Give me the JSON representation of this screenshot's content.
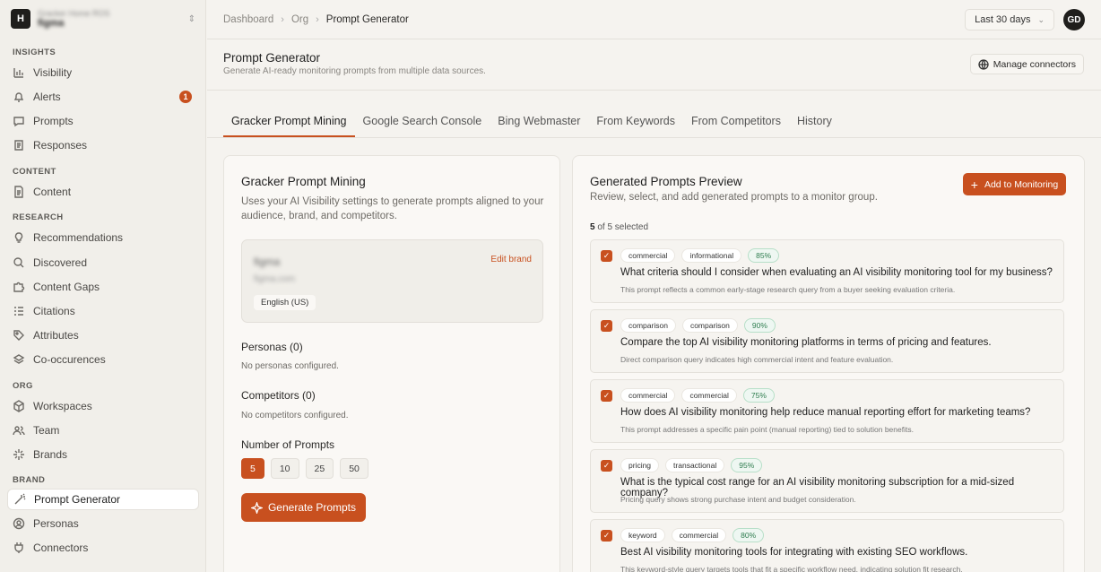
{
  "workspace": {
    "logo": "H",
    "sub": "Gracker Home ROS",
    "name": "figma"
  },
  "sidebar": {
    "sections": [
      "INSIGHTS",
      "CONTENT",
      "RESEARCH",
      "ORG",
      "BRAND"
    ],
    "items": [
      {
        "label": "Visibility",
        "icon": "bar-chart-icon"
      },
      {
        "label": "Alerts",
        "icon": "bell-icon",
        "badge": "1"
      },
      {
        "label": "Prompts",
        "icon": "message-icon"
      },
      {
        "label": "Responses",
        "icon": "clipboard-icon"
      },
      {
        "label": "Content",
        "icon": "document-icon"
      },
      {
        "label": "Recommendations",
        "icon": "lightbulb-icon"
      },
      {
        "label": "Discovered",
        "icon": "search-icon"
      },
      {
        "label": "Content Gaps",
        "icon": "puzzle-icon"
      },
      {
        "label": "Citations",
        "icon": "list-icon"
      },
      {
        "label": "Attributes",
        "icon": "tag-icon"
      },
      {
        "label": "Co-occurences",
        "icon": "layers-icon"
      },
      {
        "label": "Workspaces",
        "icon": "box-icon"
      },
      {
        "label": "Team",
        "icon": "users-icon"
      },
      {
        "label": "Brands",
        "icon": "sparkle-icon"
      },
      {
        "label": "Prompt Generator",
        "icon": "wand-icon"
      },
      {
        "label": "Personas",
        "icon": "user-circle-icon"
      },
      {
        "label": "Connectors",
        "icon": "plug-icon"
      }
    ]
  },
  "breadcrumb": [
    "Dashboard",
    "Org",
    "Prompt Generator"
  ],
  "date_range": "Last 30 days",
  "user_initials": "GD",
  "page": {
    "title": "Prompt Generator",
    "subtitle": "Generate AI-ready monitoring prompts from multiple data sources.",
    "manage_connectors": "Manage connectors"
  },
  "tabs": [
    "Gracker Prompt Mining",
    "Google Search Console",
    "Bing Webmaster",
    "From Keywords",
    "From Competitors",
    "History"
  ],
  "left": {
    "title": "Gracker Prompt Mining",
    "desc1": "Uses your AI Visibility settings to generate prompts aligned to your",
    "desc2": "audience, brand, and competitors.",
    "brand_name": "figma",
    "brand_url": "figma.com",
    "edit_brand": "Edit brand",
    "language": "English (US)",
    "personas_label": "Personas (0)",
    "personas_empty": "No personas configured.",
    "competitors_label": "Competitors (0)",
    "competitors_empty": "No competitors configured.",
    "number_label": "Number of Prompts",
    "number_options": [
      "5",
      "10",
      "25",
      "50"
    ],
    "number_selected": "5",
    "generate": "Generate Prompts"
  },
  "right": {
    "title": "Generated Prompts Preview",
    "subtitle": "Review, select, and add generated prompts to a monitor group.",
    "add": "Add to Monitoring",
    "selected_count": "5",
    "selected_suffix": "of 5 selected",
    "prompts": [
      {
        "tags": [
          "commercial",
          "informational"
        ],
        "score": "85%",
        "text": "What criteria should I consider when evaluating an AI visibility monitoring tool for my business?",
        "desc": "This prompt reflects a common early-stage research query from a buyer seeking evaluation criteria."
      },
      {
        "tags": [
          "comparison",
          "comparison"
        ],
        "score": "90%",
        "text": "Compare the top AI visibility monitoring platforms in terms of pricing and features.",
        "desc": "Direct comparison query indicates high commercial intent and feature evaluation."
      },
      {
        "tags": [
          "commercial",
          "commercial"
        ],
        "score": "75%",
        "text": "How does AI visibility monitoring help reduce manual reporting effort for marketing teams?",
        "desc": "This prompt addresses a specific pain point (manual reporting) tied to solution benefits."
      },
      {
        "tags": [
          "pricing",
          "transactional"
        ],
        "score": "95%",
        "text": "What is the typical cost range for an AI visibility monitoring subscription for a mid-sized company?",
        "desc": "Pricing query shows strong purchase intent and budget consideration."
      },
      {
        "tags": [
          "keyword",
          "commercial"
        ],
        "score": "80%",
        "text": "Best AI visibility monitoring tools for integrating with existing SEO workflows.",
        "desc": "This keyword-style query targets tools that fit a specific workflow need, indicating solution fit research."
      }
    ]
  },
  "colors": {
    "accent": "#c8501f",
    "score_green": "#2e7d4f"
  }
}
